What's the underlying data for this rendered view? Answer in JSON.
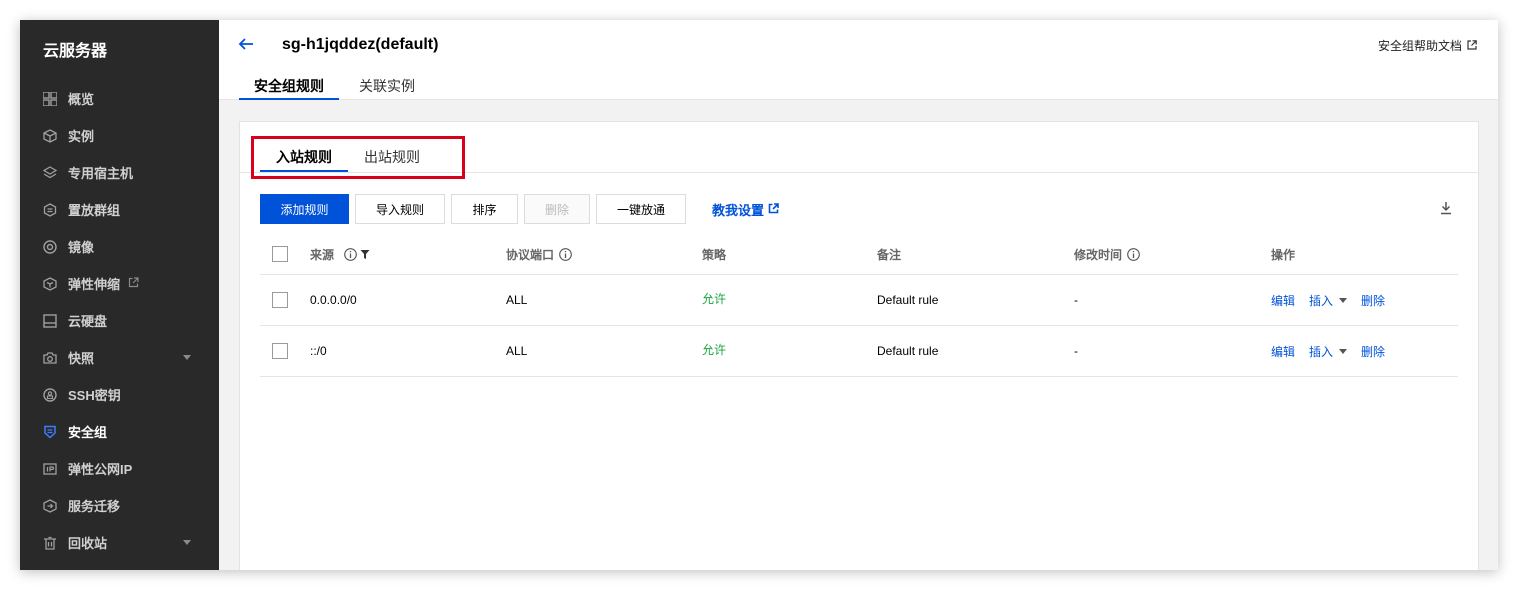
{
  "sidebar": {
    "title": "云服务器",
    "items": [
      {
        "label": "概览",
        "icon": "overview-icon"
      },
      {
        "label": "实例",
        "icon": "cube-icon"
      },
      {
        "label": "专用宿主机",
        "icon": "layers-icon"
      },
      {
        "label": "置放群组",
        "icon": "placement-icon"
      },
      {
        "label": "镜像",
        "icon": "disc-icon"
      },
      {
        "label": "弹性伸缩",
        "icon": "scaling-icon",
        "external": true
      },
      {
        "label": "云硬盘",
        "icon": "disk-icon"
      },
      {
        "label": "快照",
        "icon": "camera-icon",
        "expandable": true
      },
      {
        "label": "SSH密钥",
        "icon": "key-icon"
      },
      {
        "label": "安全组",
        "icon": "shield-icon",
        "active": true
      },
      {
        "label": "弹性公网IP",
        "icon": "ip-icon"
      },
      {
        "label": "服务迁移",
        "icon": "migrate-icon"
      },
      {
        "label": "回收站",
        "icon": "trash-icon",
        "expandable": true
      }
    ]
  },
  "header": {
    "title": "sg-h1jqddez(default)",
    "help_link": "安全组帮助文档",
    "tabs": [
      "安全组规则",
      "关联实例"
    ]
  },
  "rule_tabs": [
    "入站规则",
    "出站规则"
  ],
  "toolbar": {
    "add": "添加规则",
    "import": "导入规则",
    "sort": "排序",
    "delete": "删除",
    "open_all": "一键放通",
    "teach": "教我设置"
  },
  "table": {
    "columns": [
      "来源",
      "协议端口",
      "策略",
      "备注",
      "修改时间",
      "操作"
    ],
    "rows": [
      {
        "source": "0.0.0.0/0",
        "port": "ALL",
        "policy": "允许",
        "note": "Default rule",
        "modified": "-",
        "edit": "编辑",
        "insert": "插入",
        "delete": "删除"
      },
      {
        "source": "::/0",
        "port": "ALL",
        "policy": "允许",
        "note": "Default rule",
        "modified": "-",
        "edit": "编辑",
        "insert": "插入",
        "delete": "删除"
      }
    ]
  },
  "colors": {
    "accent": "#0052d9",
    "allow": "#1ea43f",
    "highlight": "#d9001b",
    "sidebar_bg": "#292929"
  }
}
